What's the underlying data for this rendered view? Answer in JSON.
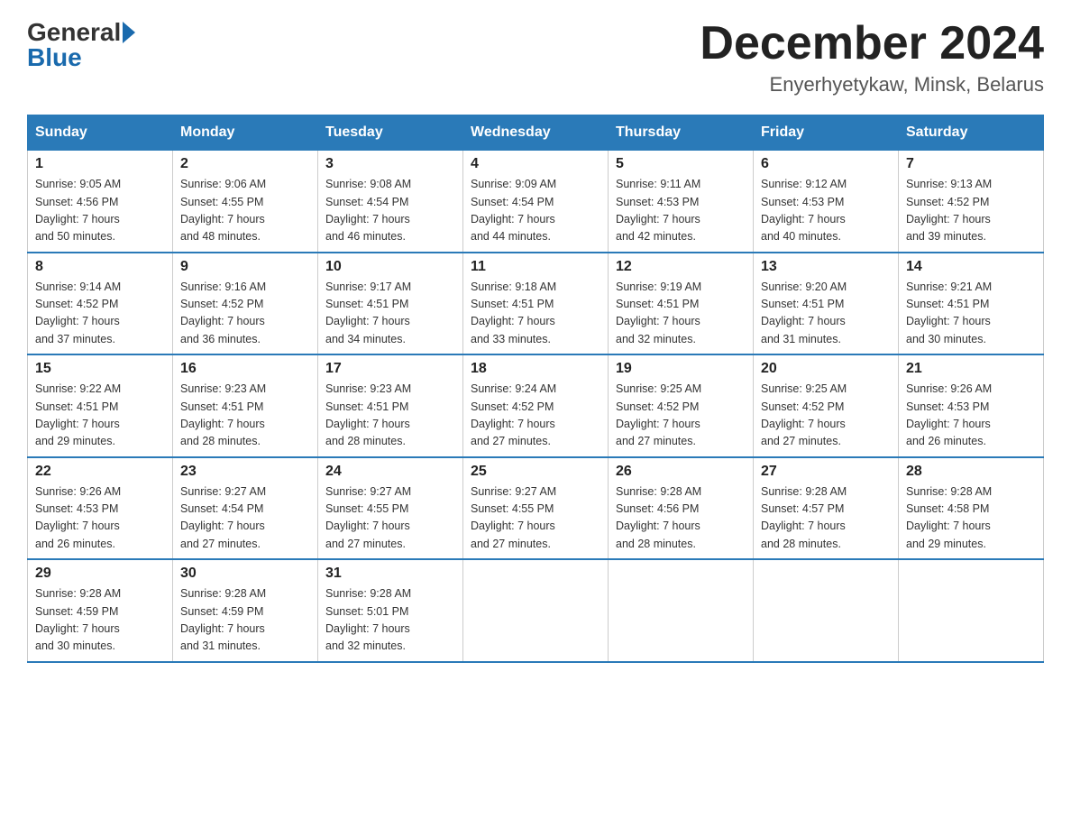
{
  "header": {
    "logo_general": "General",
    "logo_blue": "Blue",
    "title": "December 2024",
    "location": "Enyerhyetykaw, Minsk, Belarus"
  },
  "weekdays": [
    "Sunday",
    "Monday",
    "Tuesday",
    "Wednesday",
    "Thursday",
    "Friday",
    "Saturday"
  ],
  "weeks": [
    [
      {
        "day": "1",
        "info": "Sunrise: 9:05 AM\nSunset: 4:56 PM\nDaylight: 7 hours\nand 50 minutes."
      },
      {
        "day": "2",
        "info": "Sunrise: 9:06 AM\nSunset: 4:55 PM\nDaylight: 7 hours\nand 48 minutes."
      },
      {
        "day": "3",
        "info": "Sunrise: 9:08 AM\nSunset: 4:54 PM\nDaylight: 7 hours\nand 46 minutes."
      },
      {
        "day": "4",
        "info": "Sunrise: 9:09 AM\nSunset: 4:54 PM\nDaylight: 7 hours\nand 44 minutes."
      },
      {
        "day": "5",
        "info": "Sunrise: 9:11 AM\nSunset: 4:53 PM\nDaylight: 7 hours\nand 42 minutes."
      },
      {
        "day": "6",
        "info": "Sunrise: 9:12 AM\nSunset: 4:53 PM\nDaylight: 7 hours\nand 40 minutes."
      },
      {
        "day": "7",
        "info": "Sunrise: 9:13 AM\nSunset: 4:52 PM\nDaylight: 7 hours\nand 39 minutes."
      }
    ],
    [
      {
        "day": "8",
        "info": "Sunrise: 9:14 AM\nSunset: 4:52 PM\nDaylight: 7 hours\nand 37 minutes."
      },
      {
        "day": "9",
        "info": "Sunrise: 9:16 AM\nSunset: 4:52 PM\nDaylight: 7 hours\nand 36 minutes."
      },
      {
        "day": "10",
        "info": "Sunrise: 9:17 AM\nSunset: 4:51 PM\nDaylight: 7 hours\nand 34 minutes."
      },
      {
        "day": "11",
        "info": "Sunrise: 9:18 AM\nSunset: 4:51 PM\nDaylight: 7 hours\nand 33 minutes."
      },
      {
        "day": "12",
        "info": "Sunrise: 9:19 AM\nSunset: 4:51 PM\nDaylight: 7 hours\nand 32 minutes."
      },
      {
        "day": "13",
        "info": "Sunrise: 9:20 AM\nSunset: 4:51 PM\nDaylight: 7 hours\nand 31 minutes."
      },
      {
        "day": "14",
        "info": "Sunrise: 9:21 AM\nSunset: 4:51 PM\nDaylight: 7 hours\nand 30 minutes."
      }
    ],
    [
      {
        "day": "15",
        "info": "Sunrise: 9:22 AM\nSunset: 4:51 PM\nDaylight: 7 hours\nand 29 minutes."
      },
      {
        "day": "16",
        "info": "Sunrise: 9:23 AM\nSunset: 4:51 PM\nDaylight: 7 hours\nand 28 minutes."
      },
      {
        "day": "17",
        "info": "Sunrise: 9:23 AM\nSunset: 4:51 PM\nDaylight: 7 hours\nand 28 minutes."
      },
      {
        "day": "18",
        "info": "Sunrise: 9:24 AM\nSunset: 4:52 PM\nDaylight: 7 hours\nand 27 minutes."
      },
      {
        "day": "19",
        "info": "Sunrise: 9:25 AM\nSunset: 4:52 PM\nDaylight: 7 hours\nand 27 minutes."
      },
      {
        "day": "20",
        "info": "Sunrise: 9:25 AM\nSunset: 4:52 PM\nDaylight: 7 hours\nand 27 minutes."
      },
      {
        "day": "21",
        "info": "Sunrise: 9:26 AM\nSunset: 4:53 PM\nDaylight: 7 hours\nand 26 minutes."
      }
    ],
    [
      {
        "day": "22",
        "info": "Sunrise: 9:26 AM\nSunset: 4:53 PM\nDaylight: 7 hours\nand 26 minutes."
      },
      {
        "day": "23",
        "info": "Sunrise: 9:27 AM\nSunset: 4:54 PM\nDaylight: 7 hours\nand 27 minutes."
      },
      {
        "day": "24",
        "info": "Sunrise: 9:27 AM\nSunset: 4:55 PM\nDaylight: 7 hours\nand 27 minutes."
      },
      {
        "day": "25",
        "info": "Sunrise: 9:27 AM\nSunset: 4:55 PM\nDaylight: 7 hours\nand 27 minutes."
      },
      {
        "day": "26",
        "info": "Sunrise: 9:28 AM\nSunset: 4:56 PM\nDaylight: 7 hours\nand 28 minutes."
      },
      {
        "day": "27",
        "info": "Sunrise: 9:28 AM\nSunset: 4:57 PM\nDaylight: 7 hours\nand 28 minutes."
      },
      {
        "day": "28",
        "info": "Sunrise: 9:28 AM\nSunset: 4:58 PM\nDaylight: 7 hours\nand 29 minutes."
      }
    ],
    [
      {
        "day": "29",
        "info": "Sunrise: 9:28 AM\nSunset: 4:59 PM\nDaylight: 7 hours\nand 30 minutes."
      },
      {
        "day": "30",
        "info": "Sunrise: 9:28 AM\nSunset: 4:59 PM\nDaylight: 7 hours\nand 31 minutes."
      },
      {
        "day": "31",
        "info": "Sunrise: 9:28 AM\nSunset: 5:01 PM\nDaylight: 7 hours\nand 32 minutes."
      },
      null,
      null,
      null,
      null
    ]
  ]
}
